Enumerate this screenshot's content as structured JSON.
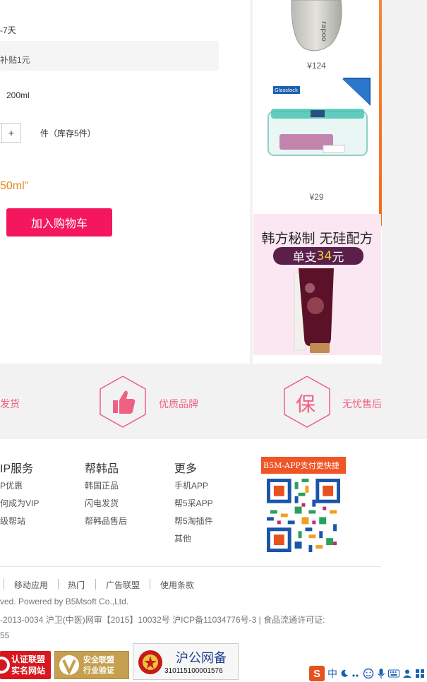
{
  "product": {
    "delivery_fragment": "-7天",
    "subsidy_fragment": "补贴1元",
    "spec_value": "200ml",
    "qty_plus": "+",
    "stock_text": "件（库存5件）",
    "title_fragment": "50ml\"",
    "add_to_cart": "加入购物车"
  },
  "sidebar": {
    "products": [
      {
        "price": "¥124"
      },
      {
        "price": "¥29",
        "brand_tag": "Glasslock"
      }
    ],
    "ad": {
      "headline": "韩方秘制 无硅配方",
      "tag_prefix": "单支",
      "tag_price": "34",
      "tag_suffix": "元"
    }
  },
  "assurance": {
    "left_fragment": "发货",
    "middle": "优质品牌",
    "right_glyph": "保",
    "right": "无忧售后"
  },
  "footer": {
    "columns": [
      {
        "title": "IP服务",
        "links": [
          "P优惠",
          "何成为VIP",
          "级帮站"
        ]
      },
      {
        "title": "帮韩品",
        "links": [
          "韩国正品",
          "闪电发货",
          "帮韩品售后"
        ]
      },
      {
        "title": "更多",
        "links": [
          "手机APP",
          "帮5采APP",
          "帮5淘插件",
          "其他"
        ]
      }
    ],
    "app_badge": "B5M-APP支付更快捷",
    "nav": [
      "移动应用",
      "热门",
      "广告联盟",
      "使用条款"
    ],
    "copyright": "ved. Powered by B5Msoft Co.,Ltd.",
    "license": "-2013-0034 沪卫(中医)网审【2015】10032号 沪ICP备11034776号-3 | 食品流通许可证:",
    "license_tail": "55",
    "badges": {
      "cert_line1": "认证联盟",
      "cert_line2": "实名网站",
      "safe_line1": "安全联盟",
      "safe_line2": "行业验证",
      "gov_title": "沪公网备",
      "gov_number": "310115100001576"
    }
  },
  "ime": {
    "logo": "S",
    "lang": "中"
  },
  "colors": {
    "accent_pink": "#f5175d",
    "assure_pink": "#f06083",
    "orange": "#f46a1c",
    "price_orange": "#e8861c"
  }
}
